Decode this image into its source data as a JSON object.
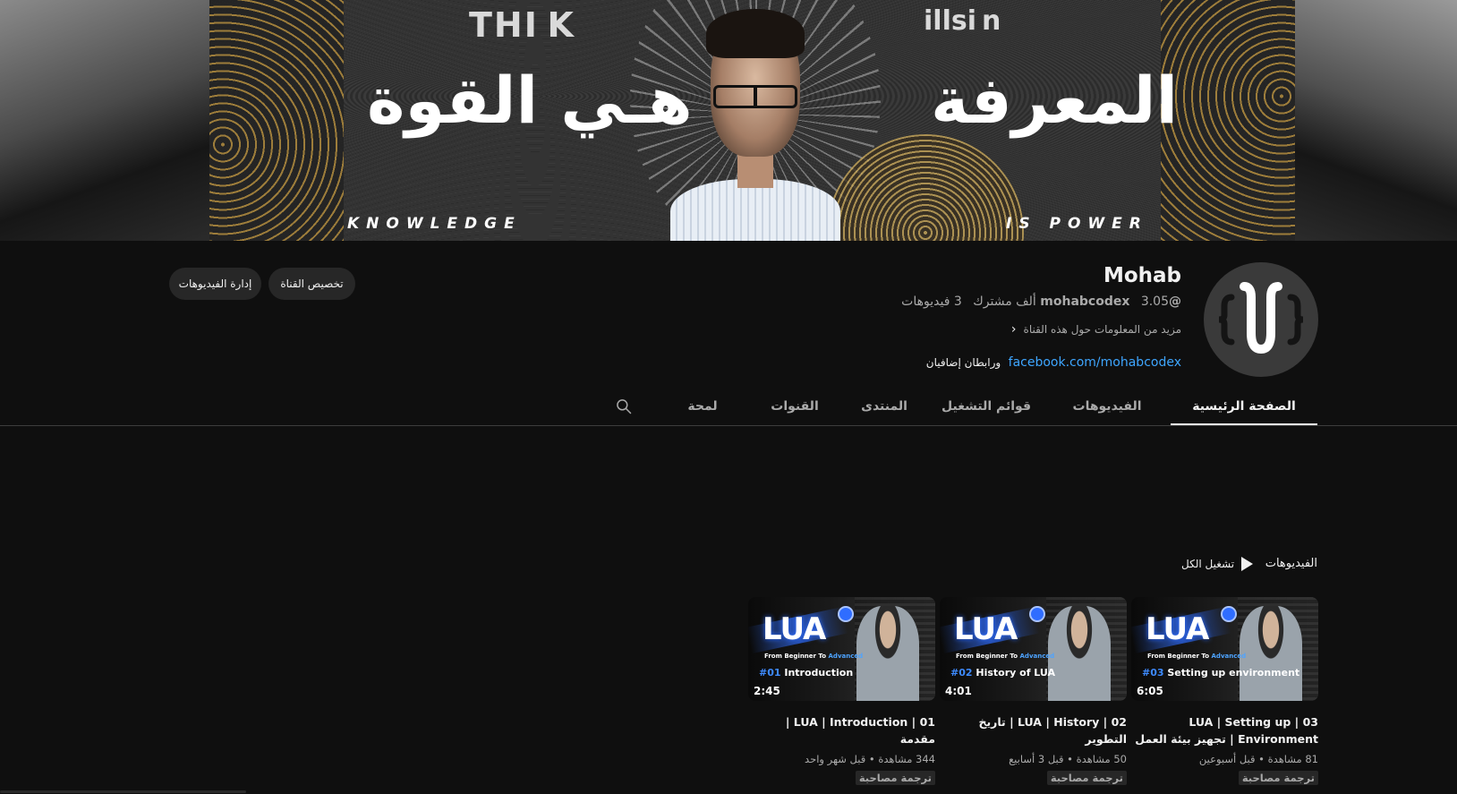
{
  "banner": {
    "think": "THI K",
    "illusion": "illsi n",
    "arabic_left": "هـي القوة",
    "arabic_right": "المعرفة",
    "knowledge": "KNOWLEDGE",
    "power": "IS POWER"
  },
  "channel": {
    "name": "Mohab",
    "handle": "@mohabcodex",
    "subscribers": "3.05 ألف مشترك",
    "videos_count": "3 فيديوهات",
    "more_info": "مزيد من المعلومات حول هذه القناة",
    "link": "facebook.com/mohabcodex",
    "more_links": "ورابطان إضافيان"
  },
  "buttons": {
    "customize": "تخصيص القناة",
    "manage": "إدارة الفيديوهات"
  },
  "tabs": {
    "home": "الصفحة الرئيسية",
    "videos": "الفيديوهات",
    "playlists": "قوائم التشغيل",
    "community": "المنتدى",
    "channels": "القنوات",
    "about": "لمحة"
  },
  "shelf": {
    "title": "الفيديوهات",
    "play_all": "تشغيل الكل"
  },
  "videos": [
    {
      "thumb_ep_num": "#03",
      "thumb_ep_title": "Setting up environment",
      "duration": "6:05",
      "title": "03 | LUA | Setting up Environment | تجهيز بيئة العمل",
      "views": "81 مشاهدة",
      "age": "قبل أسبوعين",
      "badge": "ترجمة مصاحبة"
    },
    {
      "thumb_ep_num": "#02",
      "thumb_ep_title": "History of LUA",
      "duration": "4:01",
      "title": "02 | LUA | History | تاريخ التطوير",
      "views": "50 مشاهدة",
      "age": "قبل 3 أسابيع",
      "badge": "ترجمة مصاحبة"
    },
    {
      "thumb_ep_num": "#01",
      "thumb_ep_title": "Introduction",
      "duration": "2:45",
      "title": "01 | LUA | Introduction | مقدمة",
      "views": "344 مشاهدة",
      "age": "قبل شهر واحد",
      "badge": "ترجمة مصاحبة"
    }
  ],
  "thumb_common": {
    "lua": "LUA",
    "subtitle_a": "From Beginner To",
    "subtitle_b": "Advanced"
  }
}
